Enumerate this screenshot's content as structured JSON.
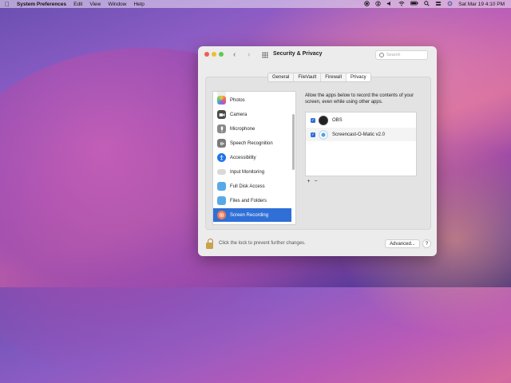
{
  "menubar": {
    "app_name": "System Preferences",
    "items": [
      "Edit",
      "View",
      "Window",
      "Help"
    ],
    "datetime": "Sat Mar 19  4:10 PM"
  },
  "window": {
    "title": "Security & Privacy",
    "search_placeholder": "Search",
    "tabs": [
      {
        "label": "General",
        "active": false
      },
      {
        "label": "FileVault",
        "active": false
      },
      {
        "label": "Firewall",
        "active": false
      },
      {
        "label": "Privacy",
        "active": true
      }
    ],
    "sidebar": [
      {
        "label": "Photos",
        "icon": "photos-icon"
      },
      {
        "label": "Camera",
        "icon": "camera-icon"
      },
      {
        "label": "Microphone",
        "icon": "microphone-icon"
      },
      {
        "label": "Speech Recognition",
        "icon": "speech-icon"
      },
      {
        "label": "Accessibility",
        "icon": "accessibility-icon"
      },
      {
        "label": "Input Monitoring",
        "icon": "keyboard-icon"
      },
      {
        "label": "Full Disk Access",
        "icon": "folder-icon"
      },
      {
        "label": "Files and Folders",
        "icon": "folder-icon"
      },
      {
        "label": "Screen Recording",
        "icon": "screen-recording-icon",
        "selected": true
      }
    ],
    "description": "Allow the apps below to record the contents of your screen, even while using other apps.",
    "apps": [
      {
        "name": "OBS",
        "checked": true
      },
      {
        "name": "Screencast-O-Matic v2.0",
        "checked": true
      }
    ],
    "add_label": "+",
    "remove_label": "−",
    "lock_message": "Click the lock to prevent further changes.",
    "advanced_label": "Advanced...",
    "help_label": "?"
  },
  "colors": {
    "accent": "#2f6fd6",
    "selection": "#2f6fd6"
  }
}
